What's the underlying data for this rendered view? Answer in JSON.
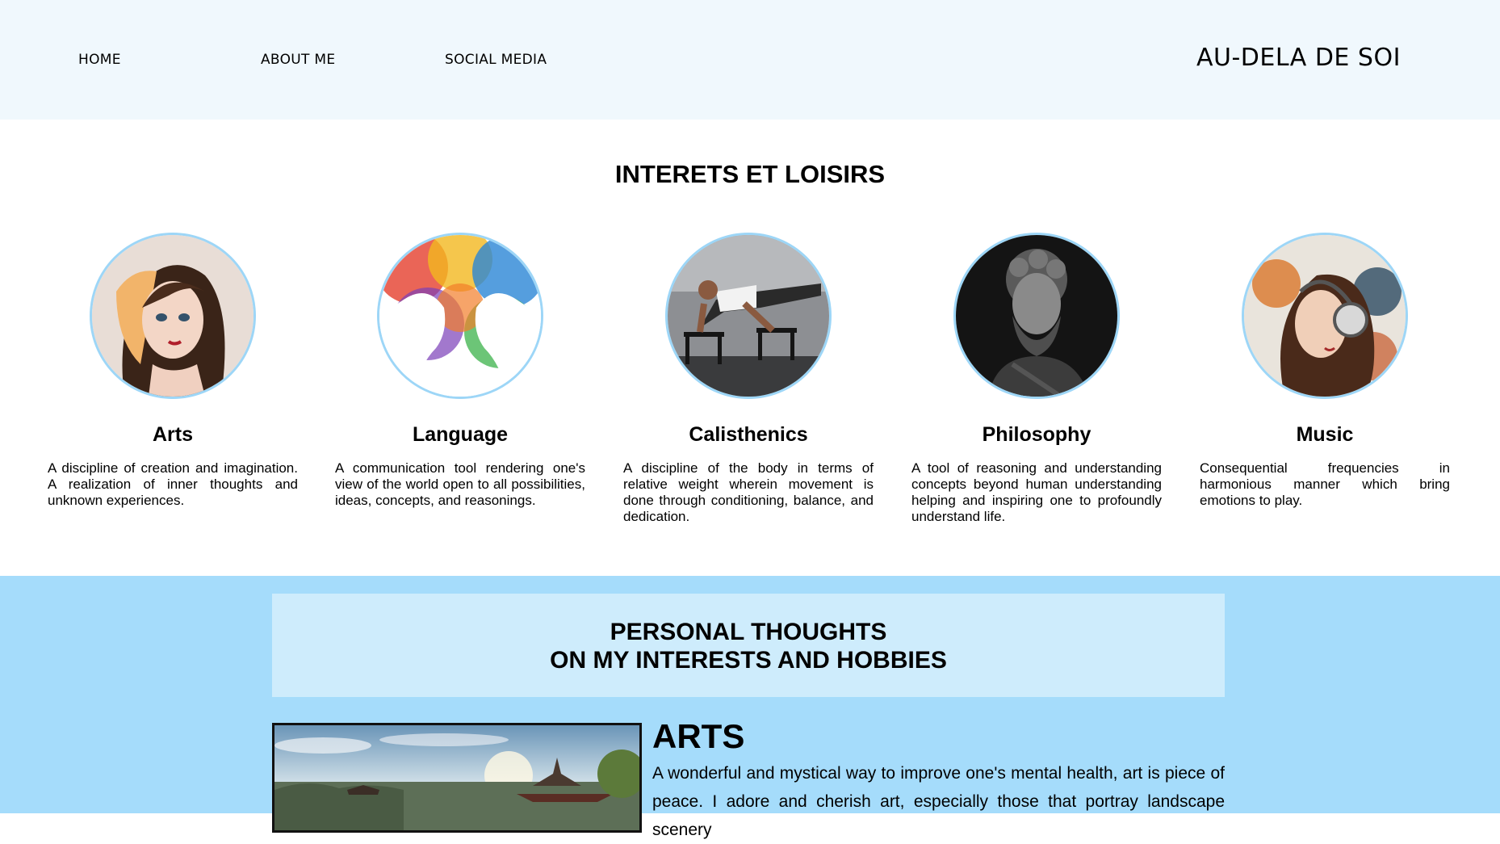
{
  "nav": {
    "items": [
      {
        "label": "HOME"
      },
      {
        "label": "ABOUT ME"
      },
      {
        "label": "SOCIAL MEDIA"
      }
    ],
    "brand": "AU-DELA DE SOI"
  },
  "interests": {
    "title": "INTERETS ET LOISIRS",
    "cards": [
      {
        "title": "Arts",
        "description": "A discipline of creation and imagination. A realization of inner thoughts and unknown experiences.",
        "image": "anime-portrait-illustration"
      },
      {
        "title": "Language",
        "description": "A communication tool rendering one's view of the world open to all possibilities, ideas, concepts, and reasonings.",
        "image": "watercolor-faces-illustration"
      },
      {
        "title": "Calisthenics",
        "description": "A discipline of the body in terms of relative weight wherein movement is done through conditioning, balance, and dedication.",
        "image": "man-on-parallettes-photo"
      },
      {
        "title": "Philosophy",
        "description": "A tool of reasoning and understanding concepts beyond human understanding helping and inspiring one to profoundly understand life.",
        "image": "philosopher-bust-photo"
      },
      {
        "title": "Music",
        "description": "Consequential frequencies in harmonious manner which bring emotions to play.",
        "image": "headphones-portrait-illustration"
      }
    ]
  },
  "thoughts": {
    "title_line1": "PERSONAL THOUGHTS",
    "title_line2": "ON MY INTERESTS AND HOBBIES",
    "arts": {
      "heading": "ARTS",
      "text": "A wonderful and mystical way to improve one's mental health, art is piece of peace. I adore and cherish art, especially those that portray landscape scenery"
    }
  },
  "colors": {
    "header_bg": "#f0f8fd",
    "circle_border": "#9dd6f7",
    "thoughts_bg": "#a5dcfb",
    "thoughts_box_bg": "#ceecfc"
  }
}
